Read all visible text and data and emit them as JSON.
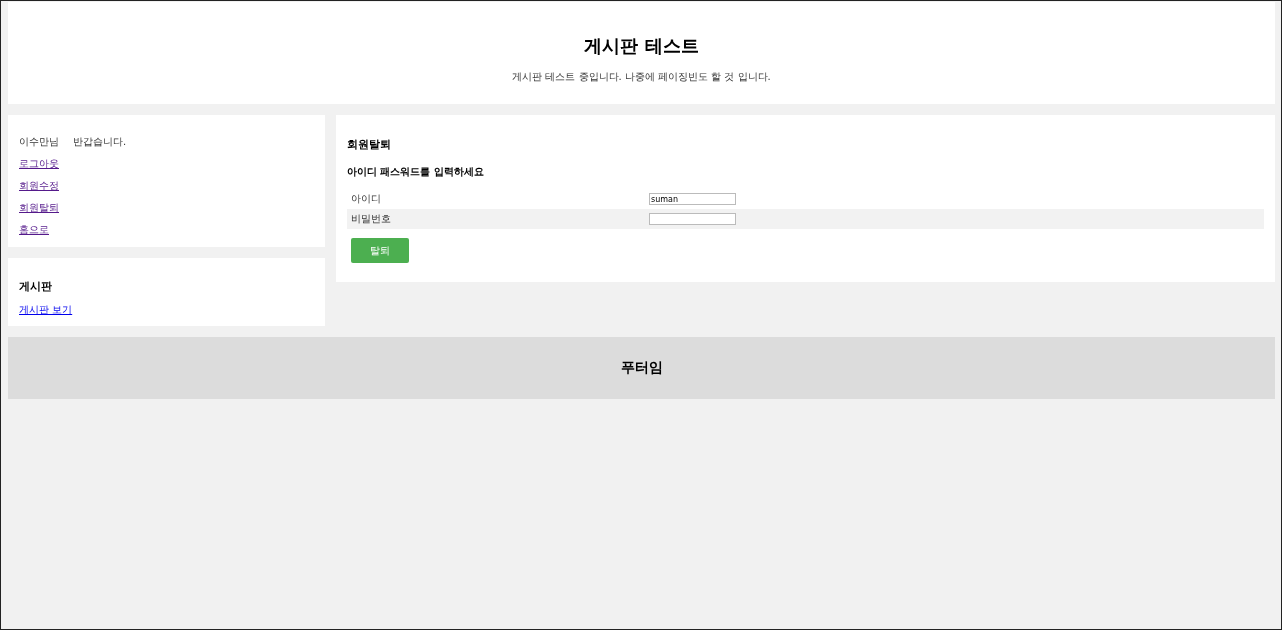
{
  "header": {
    "title": "게시판 테스트",
    "subtitle": "게시판 테스트 중입니다. 나중에 페이징빈도 할 것 입니다."
  },
  "user_card": {
    "greeting_name": "이수만님",
    "greeting": "반갑습니다.",
    "links": [
      {
        "label": "로그아웃",
        "visited": true
      },
      {
        "label": "회원수정",
        "visited": true
      },
      {
        "label": "회원탈퇴",
        "visited": true
      },
      {
        "label": "홈으로",
        "visited": true
      }
    ]
  },
  "board_card": {
    "title": "게시판",
    "links": [
      {
        "label": "게시판 보기",
        "visited": false
      }
    ]
  },
  "withdraw_form": {
    "title": "회원탈퇴",
    "instruction": "아이디 패스워드를 입력하세요",
    "fields": [
      {
        "label": "아이디",
        "value": "suman",
        "kind": "text"
      },
      {
        "label": "비밀번호",
        "kind": "password"
      }
    ],
    "submit": "탈퇴"
  },
  "footer": {
    "title": "푸터임"
  }
}
